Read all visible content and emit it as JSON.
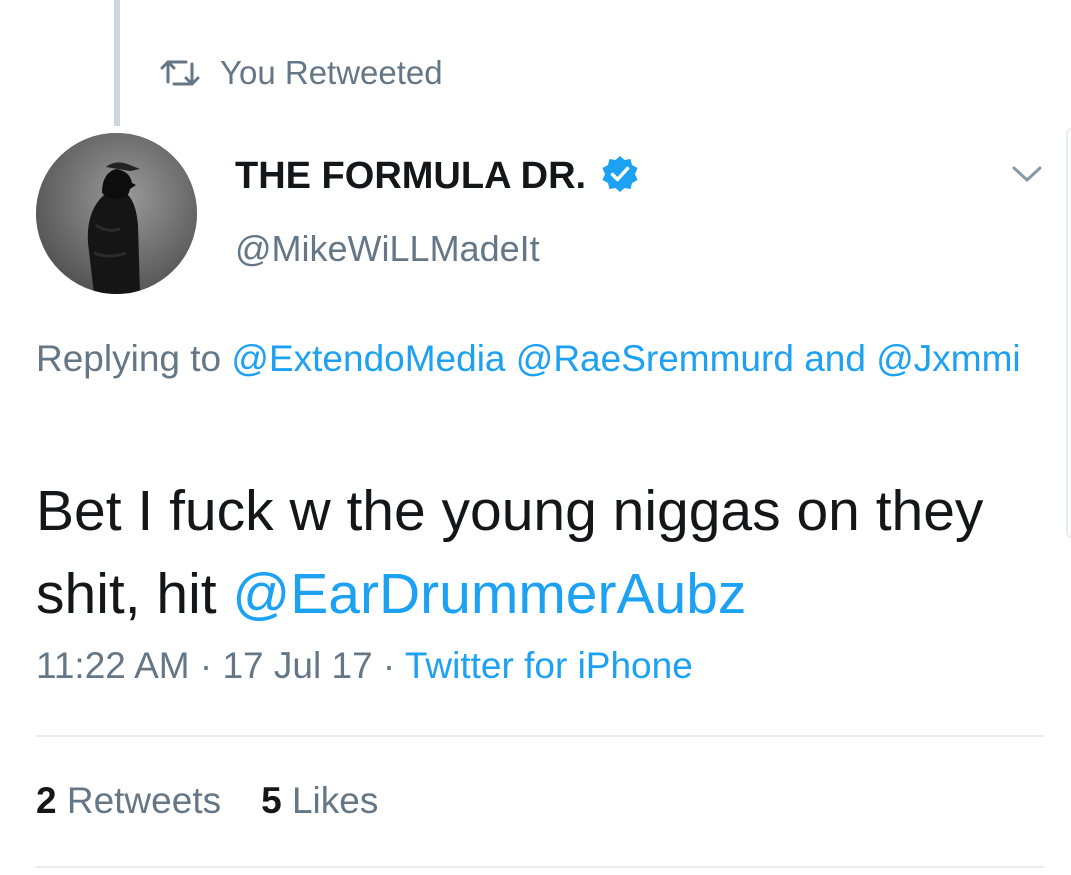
{
  "context": {
    "label": "You Retweeted",
    "icon": "retweet-icon"
  },
  "author": {
    "display_name": "THE FORMULA DR.",
    "handle": "@MikeWiLLMadeIt",
    "verified_icon": "verified-badge-icon"
  },
  "reply": {
    "prefix": "Replying to",
    "mention1": "@ExtendoMedia",
    "mention2": "@RaeSremmurd",
    "joiner": "and",
    "mention3": "@Jxmmi"
  },
  "tweet": {
    "text_before": "Bet I fuck w the young niggas on they shit, hit ",
    "mention": "@EarDrummerAubz"
  },
  "meta": {
    "time": "11:22 AM",
    "sep1": " · ",
    "date": "17 Jul 17",
    "sep2": " · ",
    "source": "Twitter for iPhone"
  },
  "stats": {
    "retweets_count": "2",
    "retweets_label": "Retweets",
    "likes_count": "5",
    "likes_label": "Likes"
  },
  "colors": {
    "accent": "#1da1f2",
    "secondary_text": "#657786",
    "primary_text": "#14171a",
    "divider": "#e6ecf0"
  }
}
